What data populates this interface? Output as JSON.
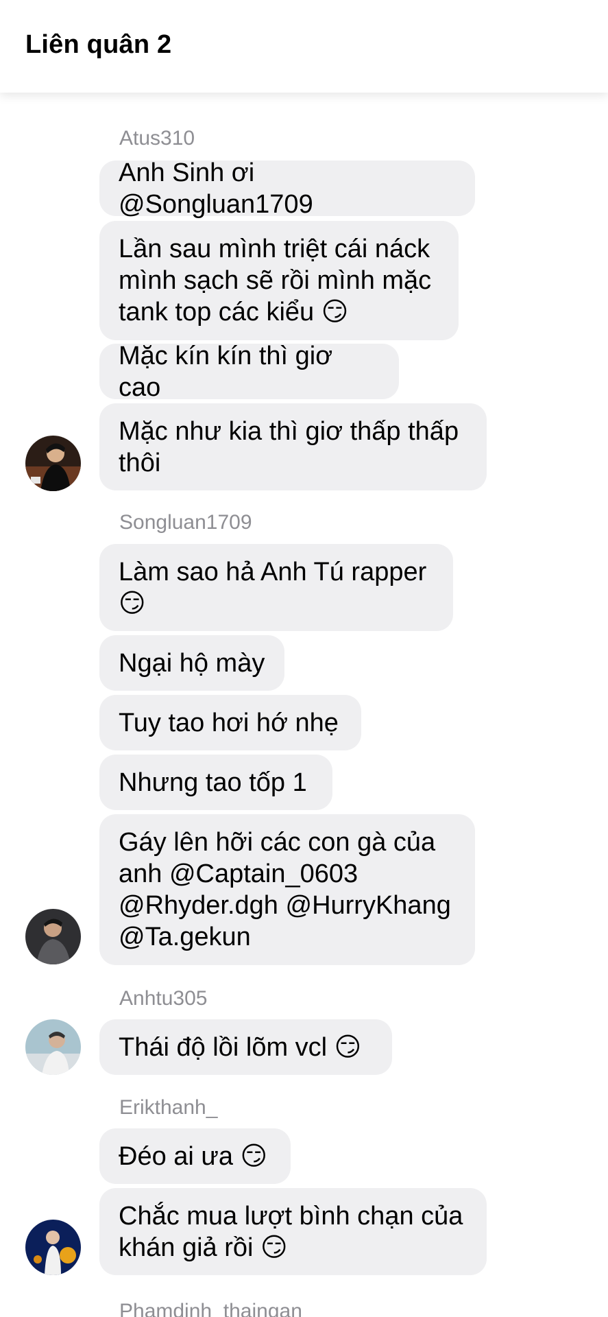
{
  "header": {
    "title": "Liên quân 2"
  },
  "groups": [
    {
      "sender": "Atus310",
      "avatar": "avatar-atus310",
      "messages": [
        "Anh Sinh ơi @Songluan1709",
        "Lần sau mình triệt cái náck mình sạch sẽ rồi mình mặc tank top các kiểu 😏",
        "Mặc kín kín thì giơ cao",
        "Mặc như kia thì giơ thấp thấp thôi"
      ]
    },
    {
      "sender": "Songluan1709",
      "avatar": "avatar-songluan1709",
      "messages": [
        "Làm sao hả Anh Tú rapper 😏",
        "Ngại hộ mày",
        "Tuy tao hơi hớ nhẹ",
        "Nhưng tao tốp 1",
        "Gáy lên hỡi các con gà của anh @Captain_0603 @Rhyder.dgh @HurryKhang @Ta.gekun"
      ]
    },
    {
      "sender": "Anhtu305",
      "avatar": "avatar-anhtu305",
      "messages": [
        "Thái độ lồi lõm vcl 😏"
      ]
    },
    {
      "sender": "Erikthanh_",
      "avatar": "avatar-erikthanh",
      "messages": [
        "Đéo ai ưa 😏",
        "Chắc mua lượt bình chạn của khán giả rồi 😏"
      ]
    },
    {
      "sender": "Phamdinh_thaingan",
      "messages": []
    }
  ],
  "colors": {
    "bubble": "#efeff1",
    "sender": "#8e8e93",
    "background": "#ffffff"
  }
}
